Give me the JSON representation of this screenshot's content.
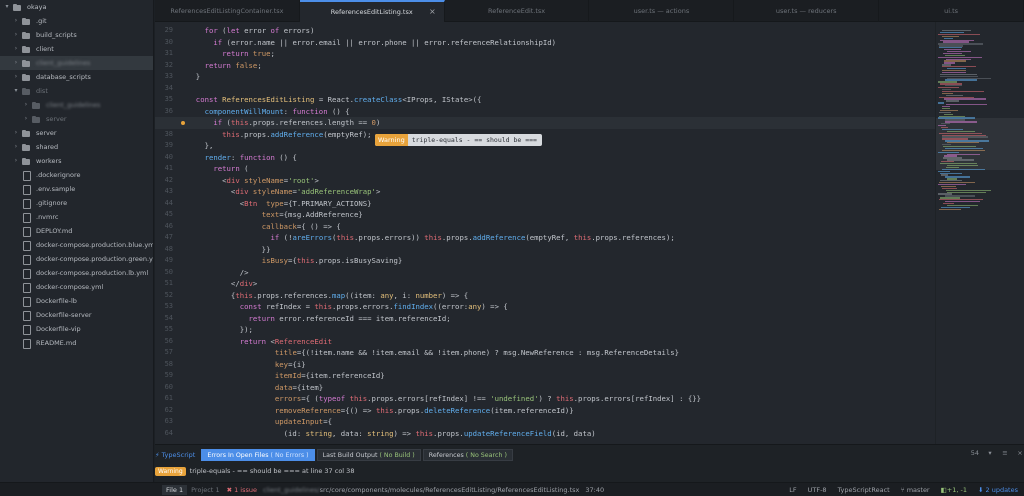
{
  "sidebar": {
    "items": [
      {
        "label": "okaya",
        "kind": "root",
        "chev": "▾",
        "state": ""
      },
      {
        "label": ".git",
        "kind": "folder",
        "chev": "›",
        "state": "",
        "indent": 1
      },
      {
        "label": "build_scripts",
        "kind": "folder",
        "chev": "›",
        "state": "",
        "indent": 1
      },
      {
        "label": "client",
        "kind": "folder",
        "chev": "›",
        "state": "",
        "indent": 1
      },
      {
        "label": "client_guidelines",
        "kind": "folder",
        "chev": "›",
        "state": "sel blur",
        "indent": 1
      },
      {
        "label": "database_scripts",
        "kind": "folder",
        "chev": "›",
        "state": "",
        "indent": 1
      },
      {
        "label": "dist",
        "kind": "folder",
        "chev": "▾",
        "state": "dim",
        "indent": 1
      },
      {
        "label": "client_guidelines",
        "kind": "folder",
        "chev": "›",
        "state": "dim blur",
        "indent": 2
      },
      {
        "label": "server",
        "kind": "folder",
        "chev": "›",
        "state": "dim",
        "indent": 2
      },
      {
        "label": "server",
        "kind": "folder",
        "chev": "›",
        "state": "",
        "indent": 1
      },
      {
        "label": "shared",
        "kind": "folder",
        "chev": "›",
        "state": "",
        "indent": 1
      },
      {
        "label": "workers",
        "kind": "folder",
        "chev": "›",
        "state": "",
        "indent": 1
      },
      {
        "label": ".dockerignore",
        "kind": "file",
        "chev": "",
        "state": "",
        "indent": 1
      },
      {
        "label": ".env.sample",
        "kind": "file",
        "chev": "",
        "state": "",
        "indent": 1
      },
      {
        "label": ".gitignore",
        "kind": "file",
        "chev": "",
        "state": "",
        "indent": 1
      },
      {
        "label": ".nvmrc",
        "kind": "file",
        "chev": "",
        "state": "",
        "indent": 1
      },
      {
        "label": "DEPLOY.md",
        "kind": "file",
        "chev": "",
        "state": "",
        "indent": 1
      },
      {
        "label": "docker-compose.production.blue.yml",
        "kind": "file",
        "chev": "",
        "state": "",
        "indent": 1
      },
      {
        "label": "docker-compose.production.green.yml",
        "kind": "file",
        "chev": "",
        "state": "",
        "indent": 1
      },
      {
        "label": "docker-compose.production.lb.yml",
        "kind": "file",
        "chev": "",
        "state": "",
        "indent": 1
      },
      {
        "label": "docker-compose.yml",
        "kind": "file",
        "chev": "",
        "state": "",
        "indent": 1
      },
      {
        "label": "Dockerfile-lb",
        "kind": "file",
        "chev": "",
        "state": "",
        "indent": 1
      },
      {
        "label": "Dockerfile-server",
        "kind": "file",
        "chev": "",
        "state": "",
        "indent": 1
      },
      {
        "label": "Dockerfile-vip",
        "kind": "file",
        "chev": "",
        "state": "",
        "indent": 1
      },
      {
        "label": "README.md",
        "kind": "file",
        "chev": "",
        "state": "",
        "indent": 1
      }
    ]
  },
  "tabs": [
    {
      "label": "ReferencesEditListingContainer.tsx",
      "active": false
    },
    {
      "label": "ReferencesEditListing.tsx",
      "active": true,
      "close": "×"
    },
    {
      "label": "ReferenceEdit.tsx",
      "active": false
    },
    {
      "label": "user.ts — actions",
      "active": false
    },
    {
      "label": "user.ts — reducers",
      "active": false
    },
    {
      "label": "ui.ts",
      "active": false
    }
  ],
  "editor": {
    "current_line": 37,
    "warning_line": 37,
    "lines": [
      {
        "n": 29,
        "html": "    <span class='k'>for</span> (<span class='k'>let</span> error <span class='k'>of</span> errors)"
      },
      {
        "n": 30,
        "html": "      <span class='k'>if</span> (error.name || error.email || error.phone || error.referenceRelationshipId)"
      },
      {
        "n": 31,
        "html": "        <span class='k'>return</span> <span class='n'>true</span>;"
      },
      {
        "n": 32,
        "html": "    <span class='k'>return</span> <span class='n'>false</span>;"
      },
      {
        "n": 33,
        "html": "  }"
      },
      {
        "n": 34,
        "html": ""
      },
      {
        "n": 35,
        "html": "  <span class='k'>const</span> <span class='t'>ReferencesEditListing</span> = React.<span class='f'>createClass</span>&lt;IProps, IState&gt;({"
      },
      {
        "n": 36,
        "html": "    <span class='f'>componentWillMount</span>: <span class='k'>function</span> () {"
      },
      {
        "n": 37,
        "html": "      <span class='k'>if</span> (<span class='p'>this</span>.props.references.length == <span class='n'>0</span>)"
      },
      {
        "n": 38,
        "html": "        <span class='p'>this</span>.props.<span class='f'>addReference</span>(emptyRef);"
      },
      {
        "n": 39,
        "html": "    },"
      },
      {
        "n": 40,
        "html": "    <span class='f'>render</span>: <span class='k'>function</span> () {"
      },
      {
        "n": 41,
        "html": "      <span class='k'>return</span> ("
      },
      {
        "n": 42,
        "html": "        &lt;<span class='tg'>div</span> <span class='at'>styleName</span>=<span class='s'>'root'</span>&gt;"
      },
      {
        "n": 43,
        "html": "          &lt;<span class='tg'>div</span> <span class='at'>styleName</span>=<span class='s'>'addReferenceWrap'</span>&gt;"
      },
      {
        "n": 44,
        "html": "            &lt;<span class='tg'>Btn</span>  <span class='at'>type</span>={T.PRIMARY_ACTIONS}"
      },
      {
        "n": 45,
        "html": "                 <span class='at'>text</span>={msg.AddReference}"
      },
      {
        "n": 46,
        "html": "                 <span class='at'>callback</span>={ () =&gt; {"
      },
      {
        "n": 47,
        "html": "                   <span class='k'>if</span> (!<span class='f'>areErrors</span>(<span class='p'>this</span>.props.errors)) <span class='p'>this</span>.props.<span class='f'>addReference</span>(emptyRef, <span class='p'>this</span>.props.references);"
      },
      {
        "n": 48,
        "html": "                 }}"
      },
      {
        "n": 49,
        "html": "                 <span class='at'>isBusy</span>={<span class='p'>this</span>.props.isBusySaving}"
      },
      {
        "n": 50,
        "html": "            /&gt;"
      },
      {
        "n": 51,
        "html": "          &lt;/<span class='tg'>div</span>&gt;"
      },
      {
        "n": 52,
        "html": "          {<span class='p'>this</span>.props.references.<span class='f'>map</span>((item: <span class='t'>any</span>, i: <span class='t'>number</span>) =&gt; {"
      },
      {
        "n": 53,
        "html": "            <span class='k'>const</span> refIndex = <span class='p'>this</span>.props.errors.<span class='f'>findIndex</span>((error:<span class='t'>any</span>) =&gt; {"
      },
      {
        "n": 54,
        "html": "              <span class='k'>return</span> error.referenceId === item.referenceId;"
      },
      {
        "n": 55,
        "html": "            });"
      },
      {
        "n": 56,
        "html": "            <span class='k'>return</span> &lt;<span class='tg'>ReferenceEdit</span>"
      },
      {
        "n": 57,
        "html": "                    <span class='at'>title</span>={(!item.name &amp;&amp; !item.email &amp;&amp; !item.phone) ? msg.NewReference : msg.ReferenceDetails}"
      },
      {
        "n": 58,
        "html": "                    <span class='at'>key</span>={i}"
      },
      {
        "n": 59,
        "html": "                    <span class='at'>itemId</span>={item.referenceId}"
      },
      {
        "n": 60,
        "html": "                    <span class='at'>data</span>={item}"
      },
      {
        "n": 61,
        "html": "                    <span class='at'>errors</span>={ (<span class='k'>typeof</span> <span class='p'>this</span>.props.errors[refIndex] !== <span class='s'>'undefined'</span>) ? <span class='p'>this</span>.props.errors[refIndex] : {}}"
      },
      {
        "n": 62,
        "html": "                    <span class='at'>removeReference</span>={() =&gt; <span class='p'>this</span>.props.<span class='f'>deleteReference</span>(item.referenceId)}"
      },
      {
        "n": 63,
        "html": "                    <span class='at'>updateInput</span>={"
      },
      {
        "n": 64,
        "html": "                      (id: <span class='t'>string</span>, data: <span class='t'>string</span>) =&gt; <span class='p'>this</span>.props.<span class='f'>updateReferenceField</span>(id, data)"
      }
    ],
    "lint_popup": {
      "badge": "Warning",
      "message": "triple-equals - == should be ==="
    }
  },
  "panel": {
    "title": "TypeScript",
    "tabs": [
      {
        "label": "Errors In Open Files",
        "note": "( No Errors )",
        "active": true
      },
      {
        "label": "Last Build Output",
        "note": "( No Build )",
        "active": false
      },
      {
        "label": "References",
        "note": "( No Search )",
        "active": false
      }
    ],
    "count": "54",
    "row": {
      "badge": "Warning",
      "message": "triple-equals - == should be === at line 37 col 38"
    }
  },
  "status": {
    "file": "File",
    "file_count": "1",
    "project": "Project",
    "project_count": "1",
    "issues": "1 issue",
    "path_blur": "client_guidelines/",
    "path": "src/core/components/molecules/ReferencesEditListing/ReferencesEditListing.tsx",
    "cursor": "37:40",
    "eol": "LF",
    "encoding": "UTF-8",
    "grammar": "TypeScriptReact",
    "branch": "master",
    "git_diff": "+1, -1",
    "updates": "2 updates"
  },
  "colors": {
    "accent": "#4c8ee8",
    "warning": "#e8a33b",
    "background": "#23272d",
    "sidebar": "#22262c"
  }
}
